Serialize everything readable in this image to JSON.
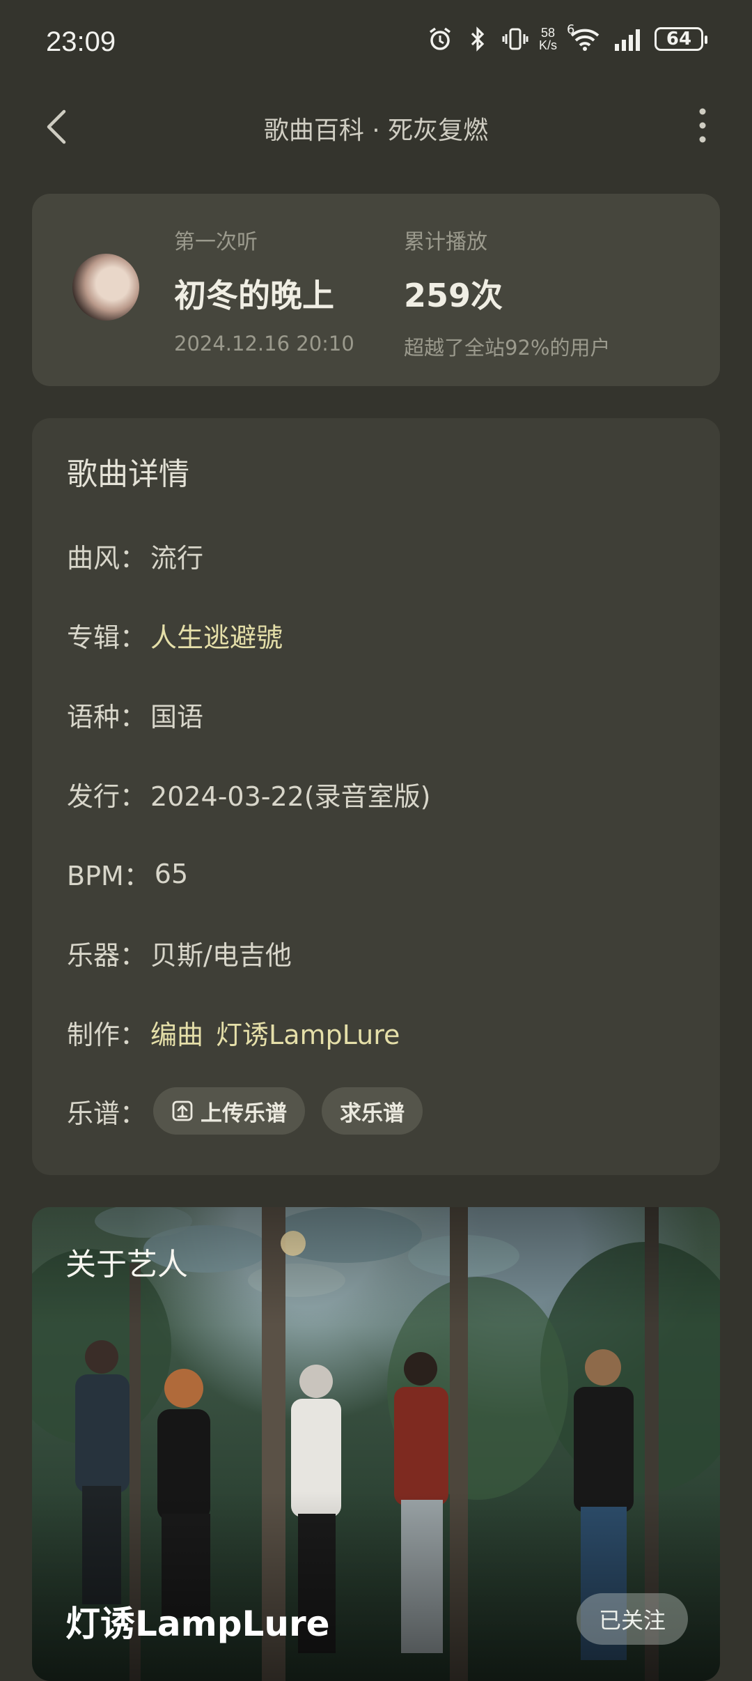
{
  "status": {
    "time": "23:09",
    "net_speed_value": "58",
    "net_speed_unit": "K/s",
    "signal_badge": "6",
    "battery": "64",
    "icons": [
      "alarm-icon",
      "bluetooth-icon",
      "vibrate-icon",
      "wifi-icon",
      "signal-icon",
      "battery-icon"
    ]
  },
  "nav": {
    "title": "歌曲百科 · 死灰复燃"
  },
  "listen": {
    "first_label": "第一次听",
    "first_value": "初冬的晚上",
    "first_time": "2024.12.16 20:10",
    "total_label": "累计播放",
    "total_value": "259次",
    "total_note": "超越了全站92%的用户"
  },
  "details": {
    "title": "歌曲详情",
    "rows": [
      {
        "key": "曲风：",
        "value": "流行"
      },
      {
        "key": "专辑：",
        "value": "人生逃避號"
      },
      {
        "key": "语种：",
        "value": "国语"
      },
      {
        "key": "发行：",
        "value": "2024-03-22(录音室版)"
      },
      {
        "key": "BPM：",
        "value": "65"
      },
      {
        "key": "乐器：",
        "value": "贝斯/电吉他"
      },
      {
        "key": "制作：",
        "value_prefix": "编曲",
        "value": "灯诱LampLure"
      }
    ],
    "sheet_key": "乐谱：",
    "upload_label": "上传乐谱",
    "request_label": "求乐谱"
  },
  "artist": {
    "section_label": "关于艺人",
    "name": "灯诱LampLure",
    "follow_label": "已关注"
  },
  "colors": {
    "background": "#34342d",
    "card": "#46463d",
    "link": "#e5dfa9"
  }
}
